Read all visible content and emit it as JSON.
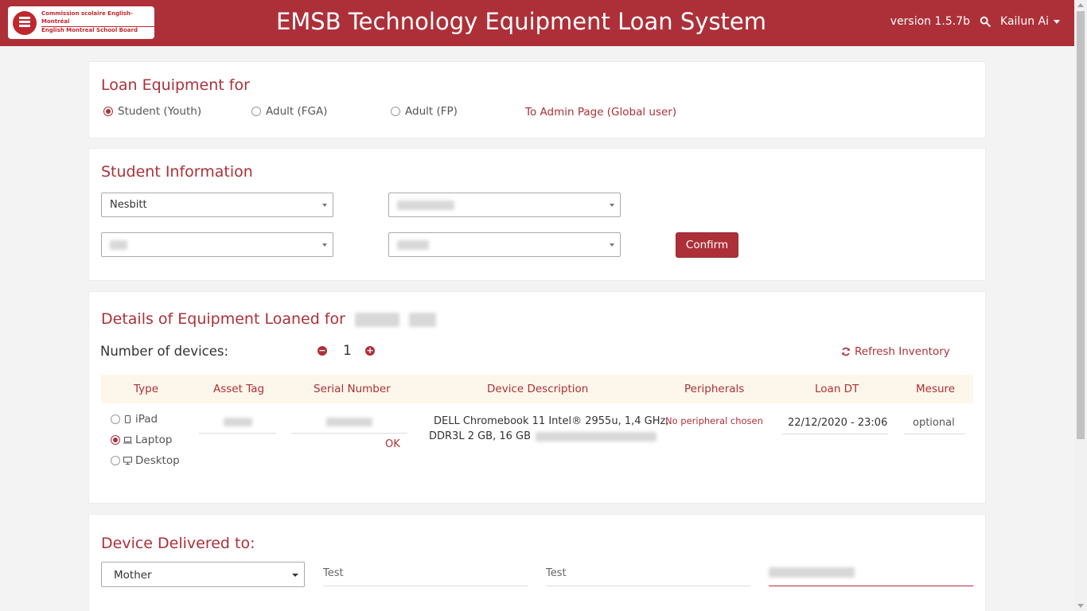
{
  "header": {
    "logo_line1": "Commission scolaire English-Montréal",
    "logo_line2": "English Montreal School Board",
    "title": "EMSB Technology Equipment Loan System",
    "version": "version 1.5.7b",
    "user": "Kailun Ai"
  },
  "loan_for": {
    "heading": "Loan Equipment for",
    "options": [
      {
        "label": "Student (Youth)",
        "checked": true
      },
      {
        "label": "Adult (FGA)",
        "checked": false
      },
      {
        "label": "Adult (FP)",
        "checked": false
      }
    ],
    "admin_link": "To Admin Page (Global user)"
  },
  "student_info": {
    "heading": "Student Information",
    "school_select": "Nesbitt",
    "confirm_label": "Confirm"
  },
  "equipment": {
    "heading": "Details of Equipment Loaned for",
    "num_devices_label": "Number of devices:",
    "count": "1",
    "refresh_label": "Refresh Inventory",
    "columns": [
      "Type",
      "Asset Tag",
      "Serial Number",
      "Device Description",
      "Peripherals",
      "Loan DT",
      "Mesure"
    ],
    "type_options": [
      {
        "label": "iPad",
        "checked": false,
        "icon": "tablet-icon"
      },
      {
        "label": "Laptop",
        "checked": true,
        "icon": "laptop-icon"
      },
      {
        "label": "Desktop",
        "checked": false,
        "icon": "desktop-icon"
      }
    ],
    "serial_status": "OK",
    "description_line1": "DELL Chromebook 11 Intel® 2955u, 1,4 GHz,",
    "description_line2": "DDR3L 2 GB, 16 GB",
    "peripherals": "No peripheral chosen",
    "loan_dt": "22/12/2020 - 23:06",
    "mesure": "optional"
  },
  "delivered": {
    "heading": "Device Delivered to:",
    "relation_select": "Mother",
    "first_name": "Test",
    "last_name": "Test"
  },
  "colors": {
    "brand": "#ad3039",
    "header_tint": "#fdf6ea"
  }
}
